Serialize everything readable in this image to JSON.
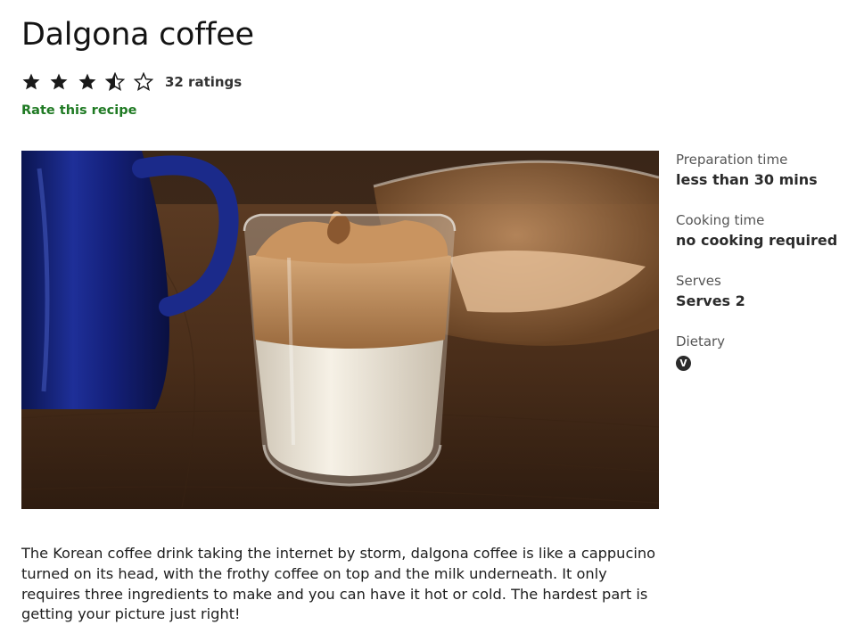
{
  "recipe": {
    "title": "Dalgona coffee",
    "rating": {
      "stars": 3.5,
      "max_stars": 5,
      "count_label": "32 ratings",
      "rate_link": "Rate this recipe"
    },
    "image": {
      "alt": "Dalgona coffee"
    },
    "details": {
      "prep_label": "Preparation time",
      "prep_value": "less than 30 mins",
      "cook_label": "Cooking time",
      "cook_value": "no cooking required",
      "serves_label": "Serves",
      "serves_value": "Serves 2",
      "dietary_label": "Dietary",
      "dietary_badge": "V"
    },
    "description": "The Korean coffee drink taking the internet by storm, dalgona coffee is like a cappucino turned on its head, with the frothy coffee on top and the milk underneath. It only requires three ingredients to make and you can have it hot or cold. The hardest part is getting your picture just right!"
  },
  "colors": {
    "link_green": "#1f7a23",
    "star": "#1a1a1a",
    "badge": "#2b2b2b"
  },
  "icons": {
    "full_star": "star-full-icon",
    "half_star": "star-half-icon",
    "empty_star": "star-empty-icon",
    "vegetarian": "vegetarian-icon"
  }
}
